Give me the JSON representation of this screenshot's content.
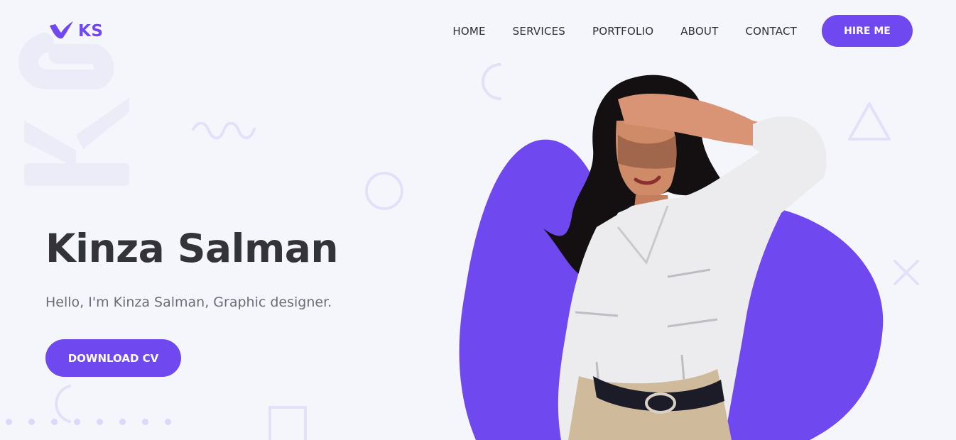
{
  "brand": {
    "logo_text": "KS",
    "logo_icon": "bird-check-icon",
    "watermark_text": "KS",
    "accent_color": "#7048f0"
  },
  "nav": {
    "items": [
      {
        "label": "HOME"
      },
      {
        "label": "SERVICES"
      },
      {
        "label": "PORTFOLIO"
      },
      {
        "label": "ABOUT"
      },
      {
        "label": "CONTACT"
      }
    ],
    "cta_label": "HIRE ME"
  },
  "hero": {
    "title": "Kinza Salman",
    "subtitle": "Hello, I'm Kinza Salman, Graphic designer.",
    "cta_label": "DOWNLOAD CV"
  },
  "colors": {
    "background": "#f5f6fb",
    "accent": "#7048f0",
    "decoration": "#e3e0fa",
    "heading": "#333338",
    "body_text": "#6d6d75"
  }
}
